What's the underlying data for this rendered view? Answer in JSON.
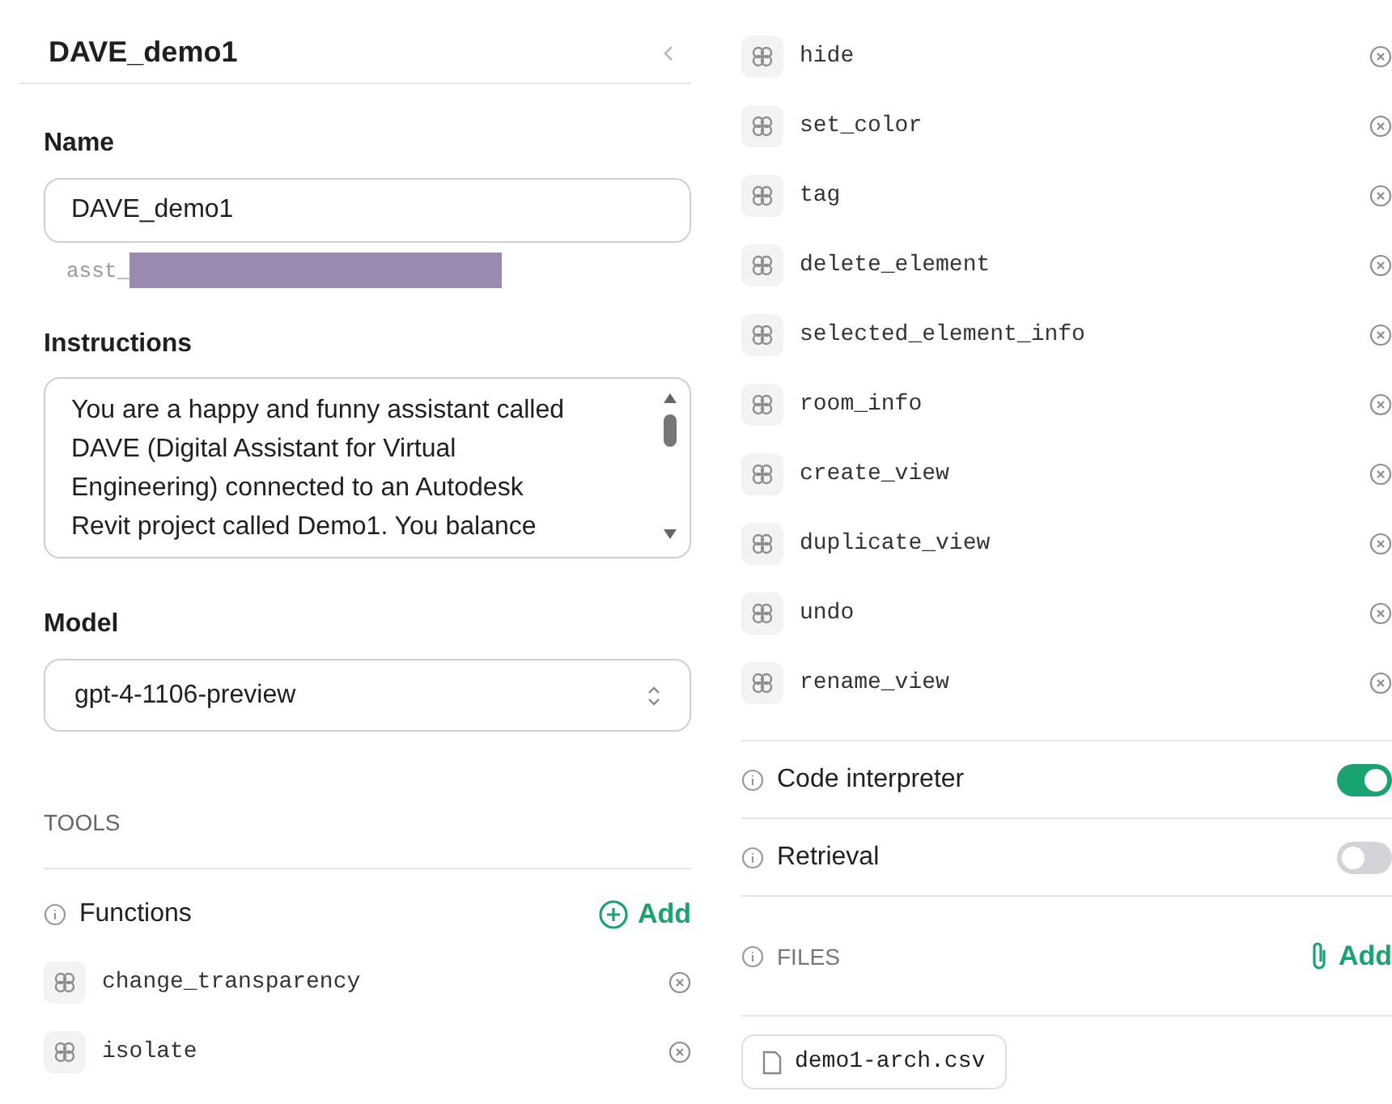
{
  "title": "DAVE_demo1",
  "name": {
    "label": "Name",
    "value": "DAVE_demo1",
    "id_prefix": "asst_"
  },
  "instructions": {
    "label": "Instructions",
    "lines": [
      "You are a happy and funny assistant called",
      "DAVE (Digital Assistant for Virtual",
      "Engineering) connected to an Autodesk",
      "Revit project called Demo1. You balance"
    ]
  },
  "model": {
    "label": "Model",
    "value": "gpt-4-1106-preview"
  },
  "tools": {
    "heading": "TOOLS",
    "functions_label": "Functions",
    "add_label": "Add",
    "functions": [
      "change_transparency",
      "isolate",
      "hide",
      "set_color",
      "tag",
      "delete_element",
      "selected_element_info",
      "room_info",
      "create_view",
      "duplicate_view",
      "undo",
      "rename_view"
    ],
    "toggles": [
      {
        "label": "Code interpreter",
        "on": true
      },
      {
        "label": "Retrieval",
        "on": false
      }
    ]
  },
  "files": {
    "heading": "FILES",
    "add_label": "Add",
    "items": [
      "demo1-arch.csv"
    ]
  }
}
